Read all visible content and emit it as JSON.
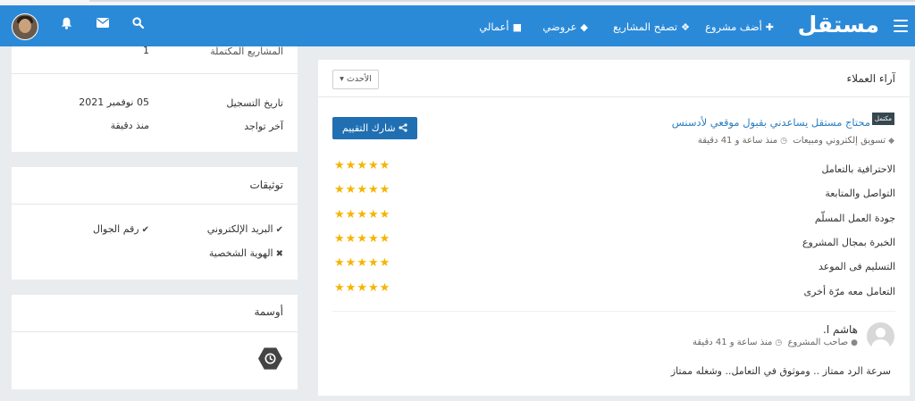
{
  "nav": {
    "logo": "مستقل",
    "items": [
      {
        "label": "أضف مشروع",
        "icon": "plus-icon"
      },
      {
        "label": "تصفح المشاريع",
        "icon": "cubes-icon"
      },
      {
        "label": "عروضي",
        "icon": "tag-icon"
      },
      {
        "label": "أعمالي",
        "icon": "briefcase-icon"
      }
    ],
    "icons": [
      "search-icon",
      "envelope-icon",
      "bell-icon"
    ]
  },
  "profile": {
    "completed_projects_label": "المشاريع المكتملة",
    "completed_projects_value": "1",
    "registration_label": "تاريخ التسجيل",
    "registration_value": "05 نوفمبر 2021",
    "last_seen_label": "آخر تواجد",
    "last_seen_value": "منذ دقيقة"
  },
  "verifications": {
    "title": "توثيقات",
    "email": {
      "label": "البريد الإلكتروني",
      "status": "verified"
    },
    "phone": {
      "label": "رقم الجوال",
      "status": "verified"
    },
    "identity": {
      "label": "الهوية الشخصية",
      "status": "unverified"
    }
  },
  "badges": {
    "title": "أوسمة",
    "items": [
      "clock-icon"
    ]
  },
  "reviews": {
    "title": "آراء العملاء",
    "sort_label": "الأحدث",
    "project": {
      "tag": "مكتمل",
      "title": "محتاج مستقل يساعدني بقبول موقعي لأدسنس",
      "category": "تسويق إلكتروني ومبيعات",
      "time": "منذ ساعة و 41 دقيقة"
    },
    "share_label": "شارك التقييم",
    "star_color": "#f5b400",
    "ratings": [
      {
        "label": "الاحترافية بالتعامل",
        "stars": 5
      },
      {
        "label": "التواصل والمتابعة",
        "stars": 5
      },
      {
        "label": "جودة العمل المسلّم",
        "stars": 5
      },
      {
        "label": "الخبرة بمجال المشروع",
        "stars": 5
      },
      {
        "label": "التسليم فى الموعد",
        "stars": 5
      },
      {
        "label": "التعامل معه مرّة أخرى",
        "stars": 5
      }
    ],
    "reviewer": {
      "name": "هاشم ا.",
      "role": "صاحب المشروع",
      "time": "منذ ساعة و 41 دقيقة",
      "comment": "سرعة الرد ممتاز .. وموثوق في التعامل.. وشغله ممتاز"
    }
  },
  "colors": {
    "navbar": "#2b8ad8",
    "link": "#2b7ec1",
    "button": "#1f6fb2"
  }
}
